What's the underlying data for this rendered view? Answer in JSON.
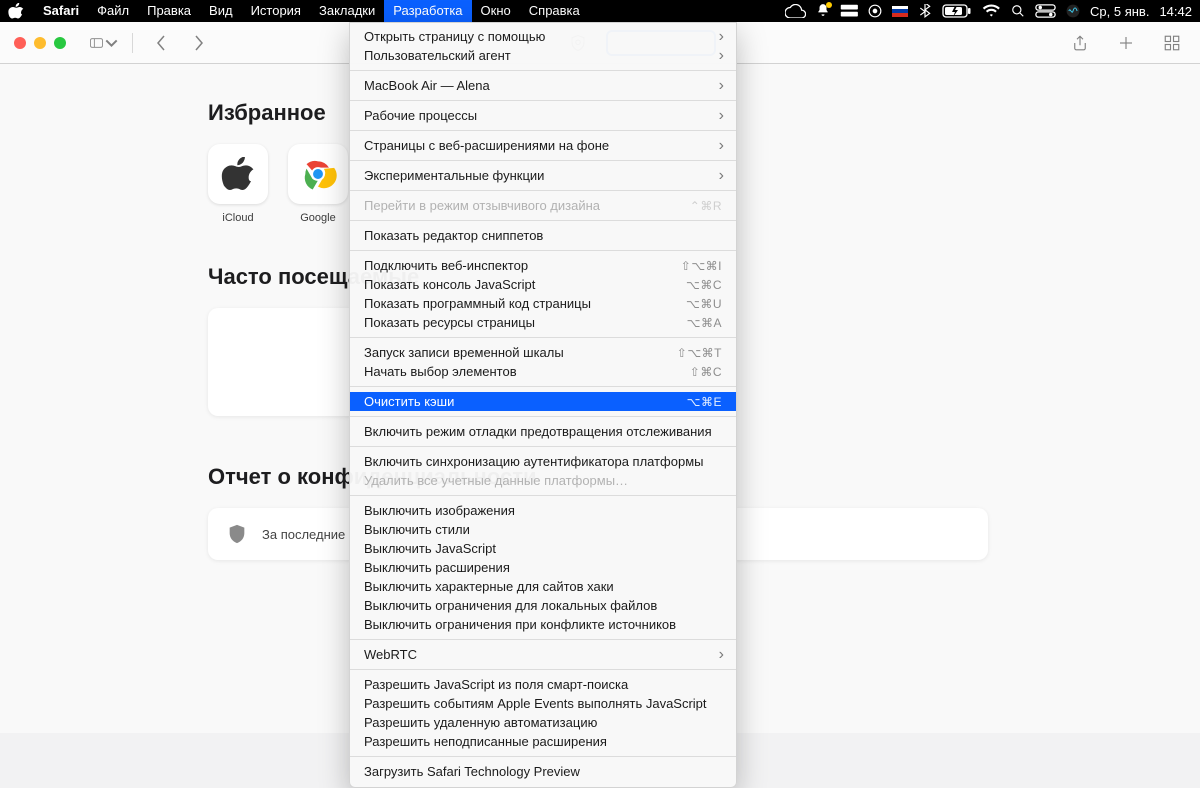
{
  "menubar": {
    "app": "Safari",
    "items": [
      "Файл",
      "Правка",
      "Вид",
      "История",
      "Закладки",
      "Разработка",
      "Окно",
      "Справка"
    ],
    "open_index": 5,
    "date": "Ср, 5 янв.",
    "time": "14:42"
  },
  "toolbar": {
    "traffic": [
      "close",
      "minimize",
      "zoom"
    ],
    "address_value": ""
  },
  "startpage": {
    "favorites_heading": "Избранное",
    "favorites": [
      {
        "name": "iCloud",
        "icon": "apple"
      },
      {
        "name": "Google",
        "icon": "chrome"
      }
    ],
    "frequently_heading": "Часто посещаемые",
    "privacy_heading": "Отчет о конфиденциальности",
    "privacy_text": "За последние"
  },
  "dev_menu": {
    "groups": [
      [
        {
          "label": "Открыть страницу с помощью",
          "sub": true
        },
        {
          "label": "Пользовательский агент",
          "sub": true
        }
      ],
      [
        {
          "label": "MacBook Air — Alena",
          "sub": true
        }
      ],
      [
        {
          "label": "Рабочие процессы",
          "sub": true
        }
      ],
      [
        {
          "label": "Страницы с веб-расширениями на фоне",
          "sub": true
        }
      ],
      [
        {
          "label": "Экспериментальные функции",
          "sub": true
        }
      ],
      [
        {
          "label": "Перейти в режим отзывчивого дизайна",
          "shortcut": "⌃⌘R",
          "disabled": true
        }
      ],
      [
        {
          "label": "Показать редактор сниппетов"
        }
      ],
      [
        {
          "label": "Подключить веб-инспектор",
          "shortcut": "⇧⌥⌘I"
        },
        {
          "label": "Показать консоль JavaScript",
          "shortcut": "⌥⌘C"
        },
        {
          "label": "Показать программный код страницы",
          "shortcut": "⌥⌘U"
        },
        {
          "label": "Показать ресурсы страницы",
          "shortcut": "⌥⌘A"
        }
      ],
      [
        {
          "label": "Запуск записи временной шкалы",
          "shortcut": "⇧⌥⌘T"
        },
        {
          "label": "Начать выбор элементов",
          "shortcut": "⇧⌘C"
        }
      ],
      [
        {
          "label": "Очистить кэши",
          "shortcut": "⌥⌘E",
          "selected": true
        }
      ],
      [
        {
          "label": "Включить режим отладки предотвращения отслеживания"
        }
      ],
      [
        {
          "label": "Включить синхронизацию аутентификатора платформы"
        },
        {
          "label": "Удалить все учетные данные платформы…",
          "disabled": true
        }
      ],
      [
        {
          "label": "Выключить изображения"
        },
        {
          "label": "Выключить стили"
        },
        {
          "label": "Выключить JavaScript"
        },
        {
          "label": "Выключить расширения"
        },
        {
          "label": "Выключить характерные для сайтов хаки"
        },
        {
          "label": "Выключить ограничения для локальных файлов"
        },
        {
          "label": "Выключить ограничения при конфликте источников"
        }
      ],
      [
        {
          "label": "WebRTC",
          "sub": true
        }
      ],
      [
        {
          "label": "Разрешить JavaScript из поля смарт-поиска"
        },
        {
          "label": "Разрешить событиям Apple Events выполнять JavaScript"
        },
        {
          "label": "Разрешить удаленную автоматизацию"
        },
        {
          "label": "Разрешить неподписанные расширения"
        }
      ],
      [
        {
          "label": "Загрузить Safari Technology Preview"
        }
      ]
    ]
  }
}
